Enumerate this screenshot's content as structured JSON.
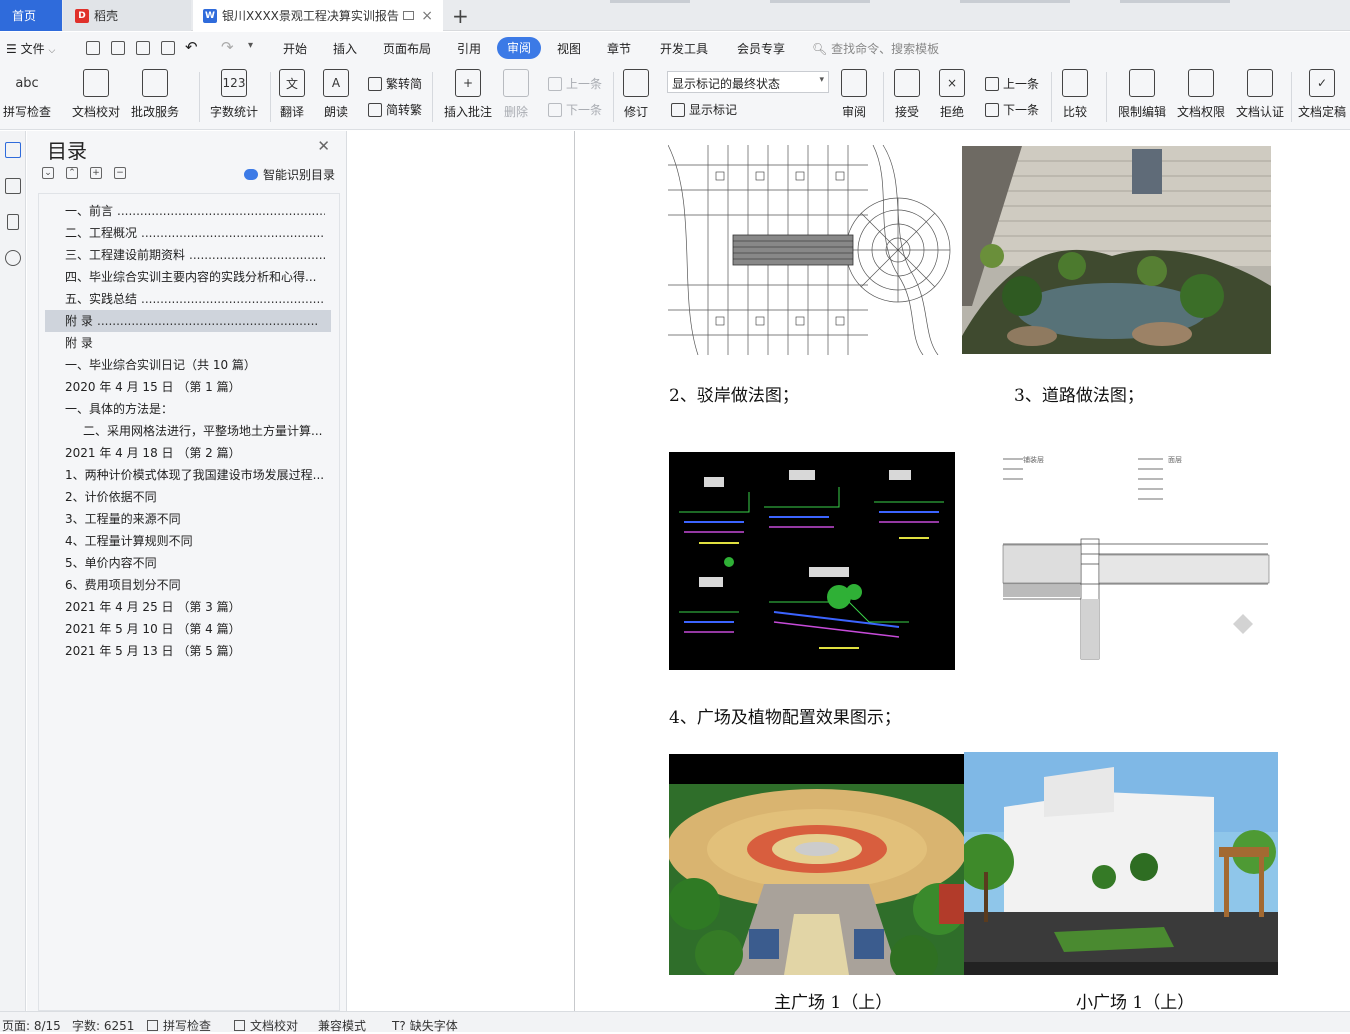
{
  "tabs": {
    "home": "首页",
    "daoke": "稻壳",
    "active_doc": "银川XXXX景观工程决算实训报告",
    "new_tab": "+"
  },
  "menu": {
    "file": "文件",
    "items": [
      "开始",
      "插入",
      "页面布局",
      "引用",
      "审阅",
      "视图",
      "章节",
      "开发工具",
      "会员专享"
    ],
    "active": "审阅",
    "search_placeholder": "查找命令、搜索模板"
  },
  "ribbon": {
    "spell_check": "拼写检查",
    "doc_proofread": "文档校对",
    "batch_service": "批改服务",
    "word_count": "字数统计",
    "translate": "翻译",
    "read_aloud": "朗读",
    "trad_to_simp": "繁转简",
    "simp_to_trad": "简转繁",
    "insert_comment": "插入批注",
    "delete": "删除",
    "prev": "上一条",
    "next": "下一条",
    "revise": "修订",
    "display_state": "显示标记的最终状态",
    "show_markup": "显示标记",
    "review": "审阅",
    "accept": "接受",
    "reject": "拒绝",
    "prev2": "上一条",
    "next2": "下一条",
    "compare": "比较",
    "restrict_edit": "限制编辑",
    "doc_permission": "文档权限",
    "doc_certify": "文档认证",
    "doc_finalize": "文档定稿"
  },
  "toc": {
    "title": "目录",
    "smart_toc": "智能识别目录",
    "items": [
      {
        "text": "一、前言",
        "dots": true,
        "indent": 0,
        "selected": false
      },
      {
        "text": "二、工程概况",
        "dots": true,
        "indent": 0,
        "selected": false
      },
      {
        "text": "三、工程建设前期资料",
        "dots": true,
        "indent": 0,
        "selected": false
      },
      {
        "text": "四、毕业综合实训主要内容的实践分析和心得...",
        "dots": false,
        "indent": 0,
        "selected": false
      },
      {
        "text": "五、实践总结",
        "dots": true,
        "indent": 0,
        "selected": false
      },
      {
        "text": "附    录",
        "dots": true,
        "indent": 0,
        "selected": true
      },
      {
        "text": "附    录",
        "dots": false,
        "indent": 0,
        "selected": false
      },
      {
        "text": "一、毕业综合实训日记（共 10 篇）",
        "dots": false,
        "indent": 0,
        "selected": false
      },
      {
        "text": "2020 年 4 月 15 日   （第 1 篇）",
        "dots": false,
        "indent": 0,
        "selected": false
      },
      {
        "text": "一、具体的方法是：",
        "dots": false,
        "indent": 0,
        "selected": false
      },
      {
        "text": "二、采用网格法进行，平整场地土方量计算...",
        "dots": false,
        "indent": 1,
        "selected": false
      },
      {
        "text": "2021 年 4 月 18 日  （第 2 篇）",
        "dots": false,
        "indent": 0,
        "selected": false
      },
      {
        "text": "1、两种计价模式体现了我国建设市场发展过程...",
        "dots": false,
        "indent": 0,
        "selected": false
      },
      {
        "text": "2、计价依据不同",
        "dots": false,
        "indent": 0,
        "selected": false
      },
      {
        "text": "3、工程量的来源不同",
        "dots": false,
        "indent": 0,
        "selected": false
      },
      {
        "text": "4、工程量计算规则不同",
        "dots": false,
        "indent": 0,
        "selected": false
      },
      {
        "text": "5、单价内容不同",
        "dots": false,
        "indent": 0,
        "selected": false
      },
      {
        "text": "6、费用项目划分不同",
        "dots": false,
        "indent": 0,
        "selected": false
      },
      {
        "text": "2021 年 4 月 25 日  （第 3 篇）",
        "dots": false,
        "indent": 0,
        "selected": false
      },
      {
        "text": "2021 年 5 月 10 日  （第 4 篇）",
        "dots": false,
        "indent": 0,
        "selected": false
      },
      {
        "text": "2021 年 5 月 13 日  （第 5 篇）",
        "dots": false,
        "indent": 0,
        "selected": false
      }
    ]
  },
  "document": {
    "caption_revetment": "2、驳岸做法图；",
    "caption_road": "3、道路做法图；",
    "caption_plaza_plants": "4、广场及植物配置效果图示；",
    "caption_main_plaza": "主广场 1（上）",
    "caption_small_plaza": "小广场 1（上）"
  },
  "status": {
    "page": "页面: 8/15",
    "word_count": "字数: 6251",
    "spell_check": "拼写检查",
    "doc_proofread": "文档校对",
    "compat_mode": "兼容模式",
    "missing_font": "缺失字体"
  },
  "colors": {
    "accent": "#3c7ae6",
    "home_tab": "#2f6bdb",
    "daoke_red": "#e0312b"
  }
}
